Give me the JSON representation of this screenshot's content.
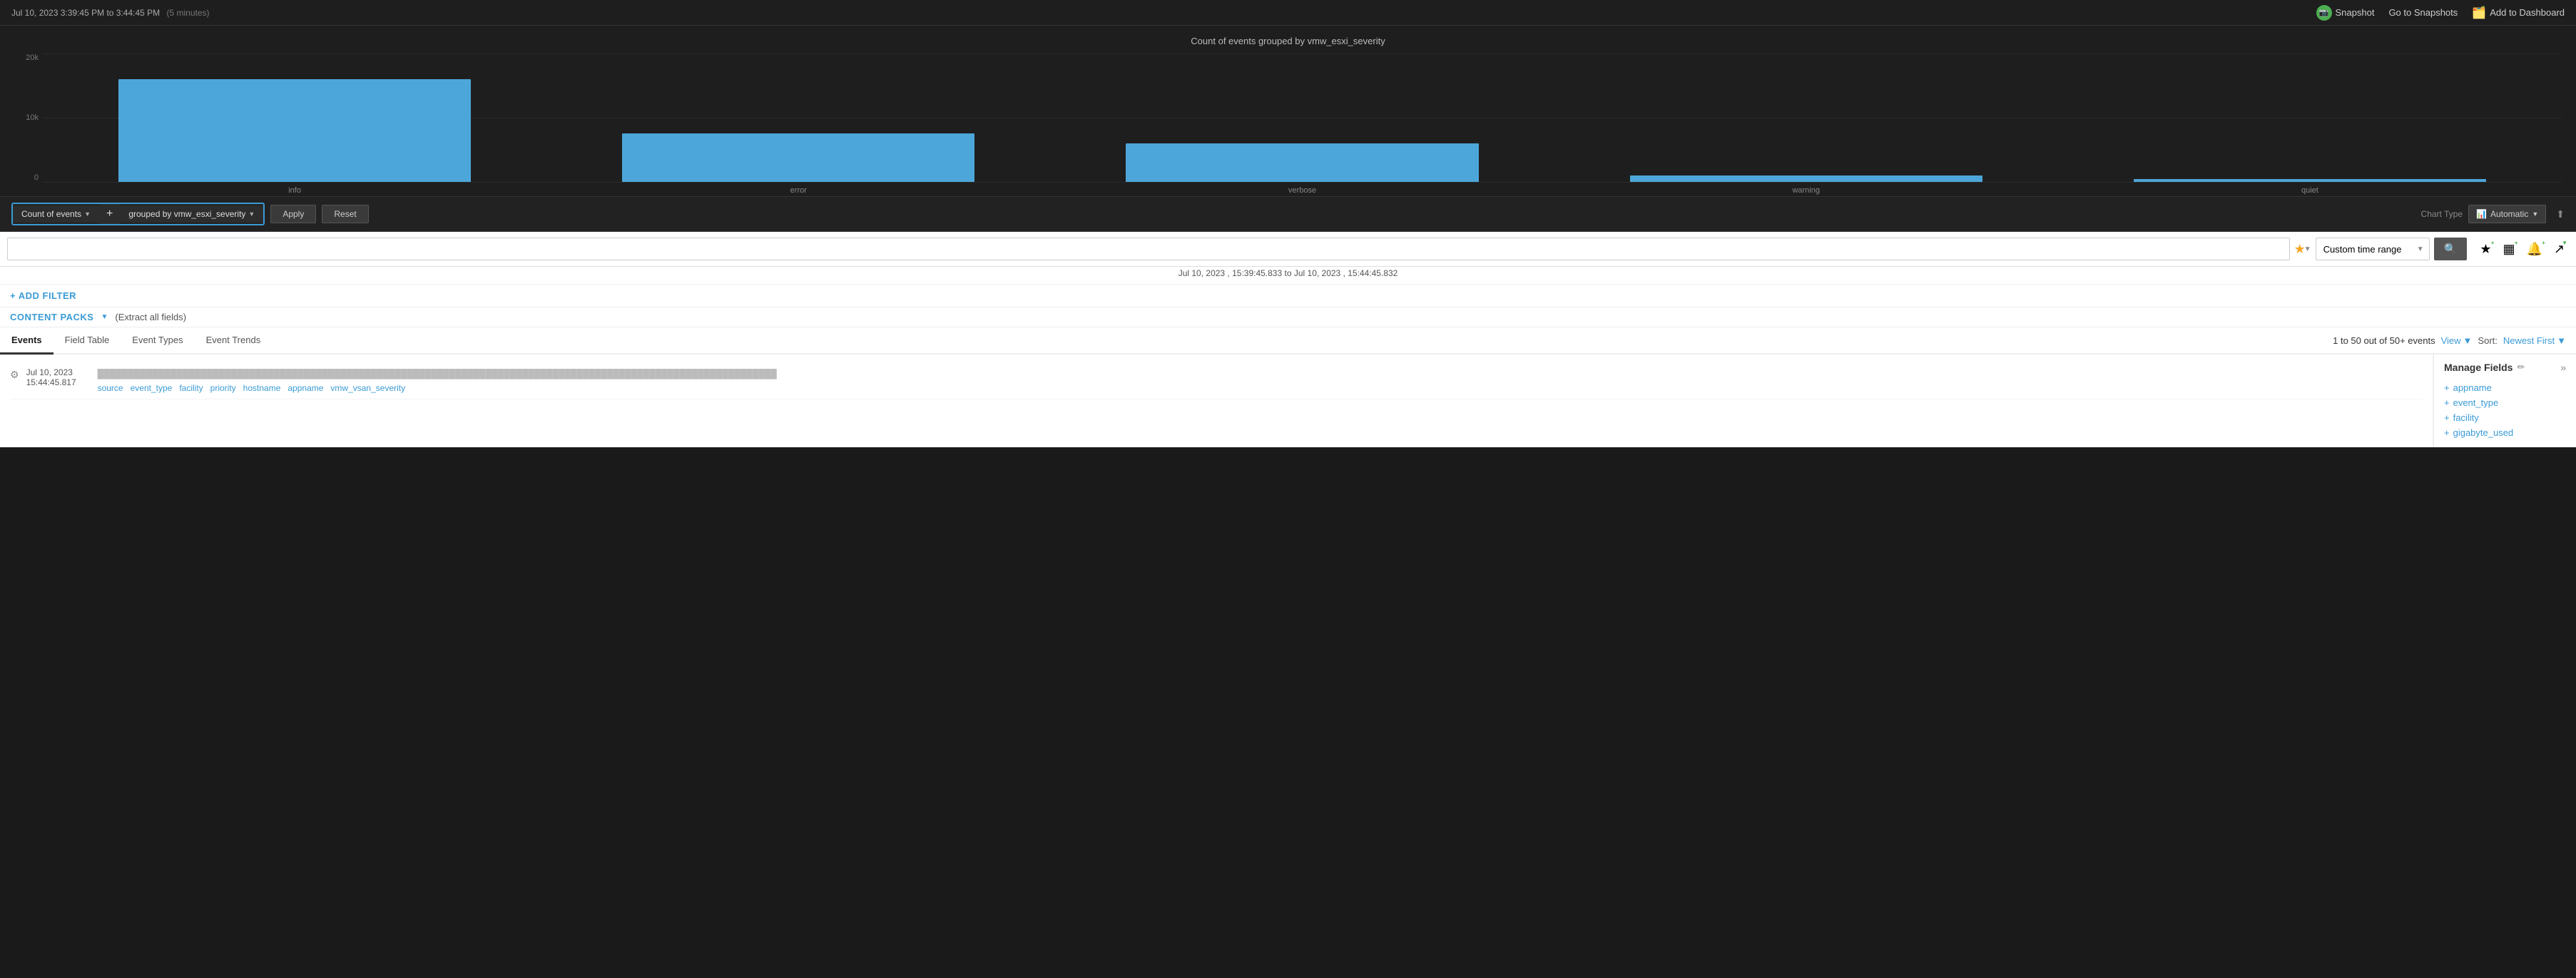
{
  "topbar": {
    "datetime": "Jul 10, 2023  3:39:45 PM",
    "to": "to",
    "datetime_end": "3:44:45 PM",
    "duration": "(5 minutes)",
    "snapshot_label": "Snapshot",
    "goto_snapshots": "Go to Snapshots",
    "add_to_dashboard": "Add to Dashboard"
  },
  "chart": {
    "title": "Count of events grouped by vmw_esxi_severity",
    "y_axis": [
      "20k",
      "10k",
      "0"
    ],
    "bars": [
      {
        "label": "info",
        "height_pct": 80
      },
      {
        "label": "error",
        "height_pct": 38
      },
      {
        "label": "verbose",
        "height_pct": 30
      },
      {
        "label": "warning",
        "height_pct": 5
      },
      {
        "label": "quiet",
        "height_pct": 2
      }
    ]
  },
  "controls": {
    "count_of_events": "Count of events",
    "grouped_by": "grouped by vmw_esxi_severity",
    "apply": "Apply",
    "reset": "Reset",
    "chart_type_label": "Chart Type",
    "chart_type_value": "Automatic"
  },
  "searchbar": {
    "placeholder": "",
    "time_range": "Custom time range",
    "search_icon": "🔍"
  },
  "date_range": {
    "start": "Jul 10, 2023 , 15:39:45.833",
    "to": "to",
    "end": "Jul 10, 2023 , 15:44:45.832"
  },
  "add_filter": {
    "label": "+ ADD FILTER"
  },
  "content_packs": {
    "label": "CONTENT PACKS",
    "extract": "(Extract all fields)"
  },
  "tabs": {
    "items": [
      "Events",
      "Field Table",
      "Event Types",
      "Event Trends"
    ]
  },
  "results": {
    "count": "1 to 50 out of 50+ events",
    "view_label": "View",
    "sort_label": "Sort:",
    "sort_value": "Newest First"
  },
  "event": {
    "timestamp": "Jul 10, 2023",
    "time": "15:44:45.817",
    "tags": [
      "source",
      "event_type",
      "facility",
      "priority",
      "hostname",
      "appname",
      "vmw_vsan_severity"
    ]
  },
  "manage_fields": {
    "title": "Manage Fields",
    "fields": [
      "appname",
      "event_type",
      "facility",
      "gigabyte_used"
    ]
  }
}
